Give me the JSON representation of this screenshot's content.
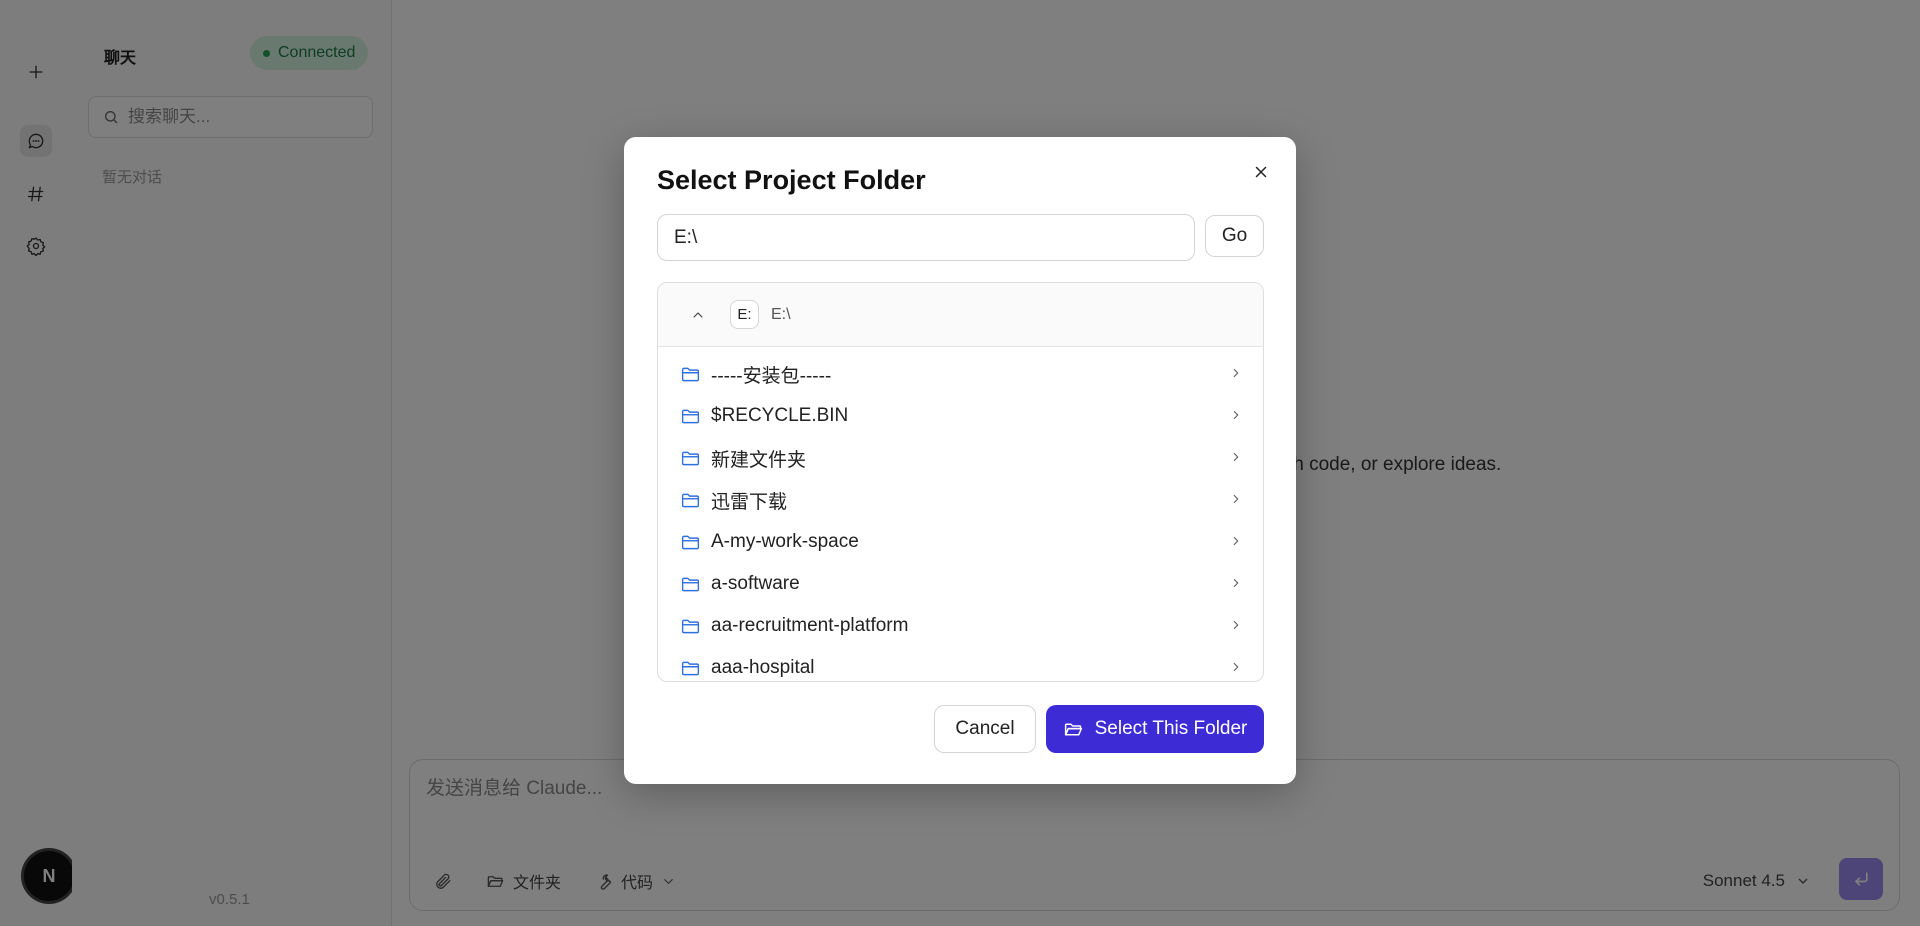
{
  "sidebar": {
    "title": "聊天",
    "status": "Connected",
    "search_placeholder": "搜索聊天...",
    "empty_text": "暂无对话",
    "version": "v0.5.1",
    "avatar_letter": "N"
  },
  "main": {
    "welcome_fragment": "with code, or explore ideas."
  },
  "composer": {
    "placeholder": "发送消息给 Claude...",
    "folder_label": "文件夹",
    "code_label": "代码",
    "model": "Sonnet 4.5"
  },
  "dialog": {
    "title": "Select Project Folder",
    "path_value": "E:\\",
    "go_label": "Go",
    "drive": "E:",
    "current_path": "E:\\",
    "folders": [
      "-----安装包-----",
      "$RECYCLE.BIN",
      "新建文件夹",
      "迅雷下载",
      "A-my-work-space",
      "a-software",
      "aa-recruitment-platform",
      "aaa-hospital"
    ],
    "cancel_label": "Cancel",
    "select_label": "Select This Folder"
  },
  "colors": {
    "accent": "#3d2bd6",
    "status_bg": "#d5f2e0",
    "status_text": "#1d7a45",
    "folder_icon": "#2f6fe0"
  }
}
